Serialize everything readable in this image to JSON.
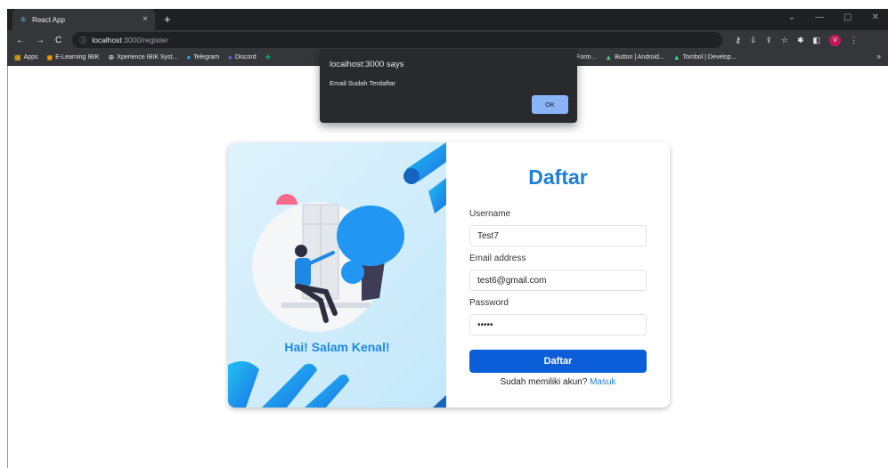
{
  "browser": {
    "tab_title": "React App",
    "tab_close": "×",
    "new_tab": "+",
    "url_host": "localhost",
    "url_path": ":3000/register",
    "bookmarks": [
      {
        "label": "Apps",
        "icon": "apps-grid-icon"
      },
      {
        "label": "E-Learning IBIK",
        "icon": "elearning-icon"
      },
      {
        "label": "Xperience IBIK Syst...",
        "icon": "globe-icon"
      },
      {
        "label": "Telegram",
        "icon": "telegram-icon"
      },
      {
        "label": "Discord",
        "icon": "discord-icon"
      }
    ],
    "bookmarks_right": [
      {
        "label": "[SIB Batch 3] Form...",
        "icon": "form-icon"
      },
      {
        "label": "Button | Android...",
        "icon": "android-icon"
      },
      {
        "label": "Tombol | Develop...",
        "icon": "android-icon"
      }
    ],
    "bookmarks_more": "»",
    "profile_initial": "V"
  },
  "dialog": {
    "title": "localhost:3000 says",
    "message": "Email Sudah Terdaftar",
    "ok_label": "OK"
  },
  "register": {
    "greeting": "Hai! Salam Kenal!",
    "title": "Daftar",
    "username_label": "Username",
    "username_value": "Test7",
    "email_label": "Email address",
    "email_value": "test6@gmail.com",
    "password_label": "Password",
    "password_value": "•••••",
    "submit_label": "Daftar",
    "footer_text": "Sudah memiliki akun?",
    "footer_link": "Masuk"
  },
  "colors": {
    "accent": "#1e7fd4",
    "button": "#0b5ed7",
    "dialog_bg": "#292a2d",
    "dialog_ok": "#8ab4f8"
  }
}
